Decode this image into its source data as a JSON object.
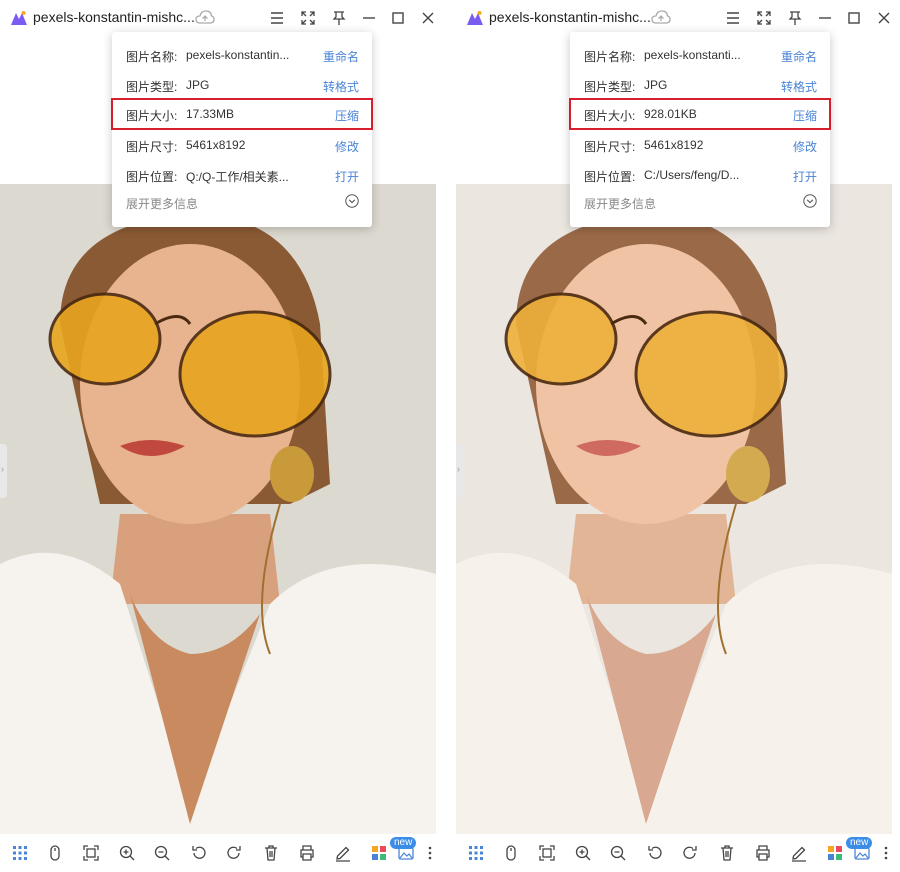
{
  "panels": [
    {
      "title": "pexels-konstantin-mishc...",
      "info": {
        "name_label": "图片名称:",
        "name_value": "pexels-konstantin...",
        "name_action": "重命名",
        "type_label": "图片类型:",
        "type_value": "JPG",
        "type_action": "转格式",
        "size_label": "图片大小:",
        "size_value": "17.33MB",
        "size_action": "压缩",
        "dims_label": "图片尺寸:",
        "dims_value": "5461x8192",
        "dims_action": "修改",
        "path_label": "图片位置:",
        "path_value": "Q:/Q-工作/相关素...",
        "path_action": "打开",
        "more_label": "展开更多信息"
      },
      "new_badge": "new"
    },
    {
      "title": "pexels-konstantin-mishc...",
      "info": {
        "name_label": "图片名称:",
        "name_value": "pexels-konstanti...",
        "name_action": "重命名",
        "type_label": "图片类型:",
        "type_value": "JPG",
        "type_action": "转格式",
        "size_label": "图片大小:",
        "size_value": "928.01KB",
        "size_action": "压缩",
        "dims_label": "图片尺寸:",
        "dims_value": "5461x8192",
        "dims_action": "修改",
        "path_label": "图片位置:",
        "path_value": "C:/Users/feng/D...",
        "path_action": "打开",
        "more_label": "展开更多信息"
      },
      "new_badge": "new"
    }
  ],
  "colors": {
    "accent_link": "#4a84d6",
    "highlight_border": "#d81e2c",
    "badge": "#3b8de8"
  },
  "icons": [
    "app-logo-icon",
    "cloud-upload-icon",
    "menu-icon",
    "fullscreen-icon",
    "pin-icon",
    "minimize-icon",
    "maximize-icon",
    "close-icon",
    "grid-icon",
    "mouse-icon",
    "fit-screen-icon",
    "zoom-in-icon",
    "zoom-out-icon",
    "rotate-left-icon",
    "rotate-right-icon",
    "delete-icon",
    "print-icon",
    "edit-icon",
    "apps-icon",
    "gallery-icon",
    "more-icon"
  ]
}
